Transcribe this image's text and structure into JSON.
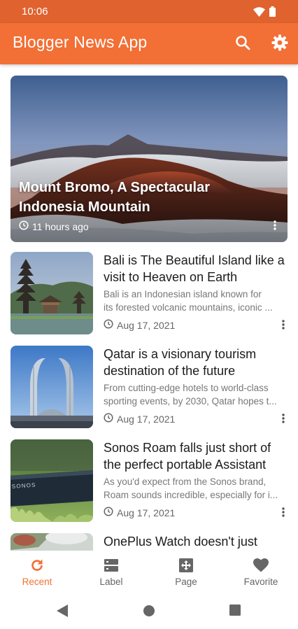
{
  "status_bar": {
    "time": "10:06"
  },
  "app_bar": {
    "title": "Blogger News App",
    "actions": [
      {
        "icon": "search-icon"
      },
      {
        "icon": "gear-icon"
      }
    ]
  },
  "featured": {
    "title": "Mount Bromo, A Spectacular Indonesia Mountain",
    "time": "11 hours ago"
  },
  "posts": [
    {
      "title": "Bali is The Beautiful Island like a visit to Heaven on Earth",
      "excerpt_line1": "Bali is an Indonesian island known for",
      "excerpt_line2": "its forested volcanic mountains, iconic ...",
      "date": "Aug 17, 2021"
    },
    {
      "title": "Qatar is a visionary tourism destination of the future",
      "excerpt_line1": "From cutting-edge hotels to world-class",
      "excerpt_line2": "sporting events, by 2030, Qatar hopes t...",
      "date": "Aug 17, 2021"
    },
    {
      "title": "Sonos Roam falls just short of the perfect portable Assistant",
      "excerpt_line1": "As you'd expect from the Sonos brand,",
      "excerpt_line2": "Roam sounds incredible, especially for i...",
      "date": "Aug 17, 2021"
    },
    {
      "title": "OnePlus Watch doesn't just"
    }
  ],
  "bottom_nav": [
    {
      "label": "Recent",
      "icon": "refresh-icon",
      "active": true
    },
    {
      "label": "Label",
      "icon": "label-icon",
      "active": false
    },
    {
      "label": "Page",
      "icon": "page-icon",
      "active": false
    },
    {
      "label": "Favorite",
      "icon": "heart-icon",
      "active": false
    }
  ],
  "colors": {
    "primary": "#f26f35",
    "status_bar": "#e0622f",
    "text_primary": "#1b1b1b",
    "text_secondary": "#777777"
  },
  "thumb_text": {
    "sonos": "SONOS"
  }
}
